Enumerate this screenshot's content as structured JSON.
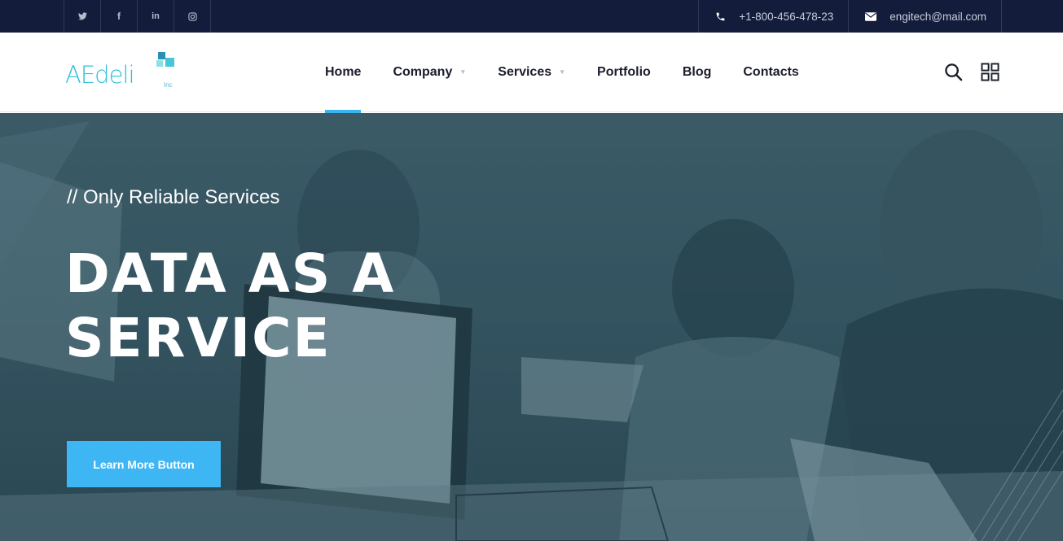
{
  "topbar": {
    "social": [
      {
        "name": "twitter-icon",
        "glyph": "🐦"
      },
      {
        "name": "facebook-icon",
        "glyph": "f"
      },
      {
        "name": "linkedin-icon",
        "glyph": "in"
      },
      {
        "name": "instagram-icon",
        "glyph": "◎"
      }
    ],
    "phone": "+1-800-456-478-23",
    "email": "engitech@mail.com"
  },
  "header": {
    "logo_text": "AEdeli",
    "logo_suffix": "Inc",
    "nav": [
      {
        "label": "Home",
        "active": true,
        "dropdown": false
      },
      {
        "label": "Company",
        "active": false,
        "dropdown": true
      },
      {
        "label": "Services",
        "active": false,
        "dropdown": true
      },
      {
        "label": "Portfolio",
        "active": false,
        "dropdown": false
      },
      {
        "label": "Blog",
        "active": false,
        "dropdown": false
      },
      {
        "label": "Contacts",
        "active": false,
        "dropdown": false
      }
    ],
    "icons": [
      "search-icon",
      "grid-menu-icon"
    ]
  },
  "hero": {
    "subtitle": "// Only Reliable Services",
    "headline_line1": "DATA AS A",
    "headline_line2": "SERVICE",
    "cta_label": "Learn More Button"
  },
  "colors": {
    "topbar_bg": "#131c3b",
    "accent": "#3fb6f4",
    "logo": "#2bc0d8"
  }
}
